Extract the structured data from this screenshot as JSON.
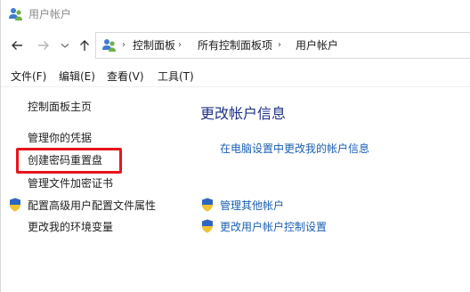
{
  "window": {
    "title": "用户帐户",
    "title_icon": "users-icon"
  },
  "navigation": {
    "back_icon": "arrow-left-icon",
    "forward_icon": "arrow-right-icon",
    "recent_icon": "chevron-down-icon",
    "up_icon": "arrow-up-icon"
  },
  "address_bar": {
    "icon": "control-panel-icon",
    "breadcrumbs": [
      "控制面板",
      "所有控制面板项",
      "用户帐户"
    ],
    "separator": "›"
  },
  "menu": {
    "items": [
      "文件(F)",
      "编辑(E)",
      "查看(V)",
      "工具(T)"
    ]
  },
  "sidebar": {
    "items": [
      {
        "label": "控制面板主页",
        "shield": false
      },
      {
        "label": "管理你的凭据",
        "shield": false
      },
      {
        "label": "创建密码重置盘",
        "shield": false,
        "highlighted": true
      },
      {
        "label": "管理文件加密证书",
        "shield": false
      },
      {
        "label": "配置高级用户配置文件属性",
        "shield": true
      },
      {
        "label": "更改我的环境变量",
        "shield": false
      }
    ]
  },
  "main": {
    "heading": "更改帐户信息",
    "link_primary": "在电脑设置中更改我的帐户信息",
    "links": [
      {
        "label": "管理其他帐户",
        "shield": true
      },
      {
        "label": "更改用户帐户控制设置",
        "shield": true
      }
    ]
  },
  "colors": {
    "highlight_border": "#e8141c",
    "link": "#1a5fb4",
    "heading": "#1e3287"
  }
}
